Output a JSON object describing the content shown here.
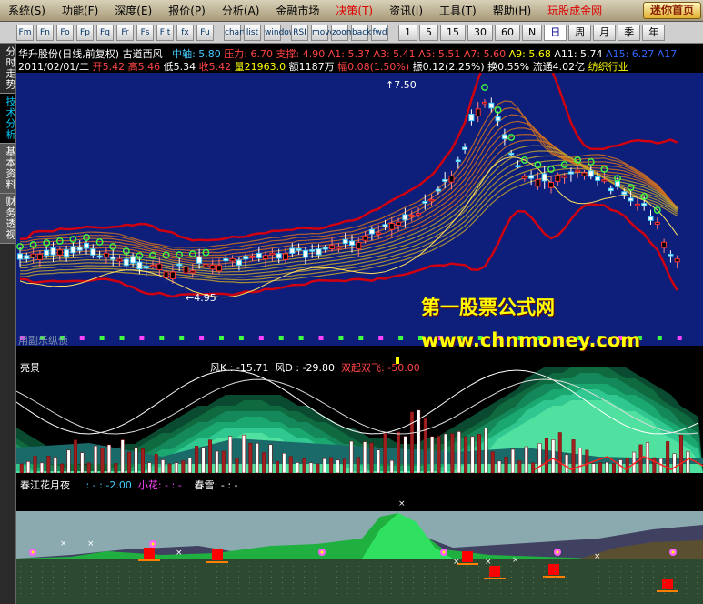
{
  "menu": {
    "items": [
      "系统(S)",
      "功能(F)",
      "深度(E)",
      "报价(P)",
      "分析(A)",
      "金融市场",
      "决策(T)",
      "资讯(I)",
      "工具(T)",
      "帮助(H)",
      "玩股成金网"
    ],
    "mini_button": "迷你首页"
  },
  "toolbar": {
    "icons": [
      "Fm",
      "Fn",
      "Fo",
      "Fp",
      "Fq",
      "Fr",
      "Fs",
      "F t",
      "fx",
      "Fu",
      "chart",
      "list",
      "window",
      "RSI",
      "move",
      "zoom",
      "back",
      "fwd"
    ],
    "periods": [
      "1",
      "5",
      "15",
      "30",
      "60",
      "N",
      "日",
      "周",
      "月",
      "季",
      "年"
    ],
    "selected_period": "日"
  },
  "left_tabs": [
    "分时走势",
    "技术分析",
    "基本资料",
    "财务透视"
  ],
  "info": {
    "stock": "华升股份(日线,前复权) 古道西风",
    "mid_label": "中轴:",
    "mid_val": "5.80",
    "press_label": "压力:",
    "press_val": "6.70",
    "support_label": "支撑:",
    "support_val": "4.90",
    "a1": "A1: 5.37",
    "a3": "A3: 5.41",
    "a5": "A5: 5.51",
    "a7": "A7: 5.60",
    "a9": "A9: 5.68",
    "a11": "A11: 5.74",
    "a15": "A15: 6.27",
    "a17": "A17",
    "date": "2011/02/01/二",
    "open": "开5.42",
    "high": "高5.46",
    "low": "低5.34",
    "close": "收5.42",
    "vol": "量21963.0",
    "amt": "额1187万",
    "range": "幅0.08(1.50%)",
    "swing": "振0.12(2.25%)",
    "turn": "换0.55%",
    "float": "流通4.02亿",
    "industry": "纺织行业"
  },
  "main_chart": {
    "high_label": "7.50",
    "low_label": "4.95",
    "ghost_text": "用副乐纵侦"
  },
  "watermark": {
    "line1": "第一股票公式网",
    "line2": "www.chnmoney.com"
  },
  "panel_mid": {
    "name": "亮景",
    "k_label": "风K",
    "k_val": ": -15.71",
    "d_label": "风D",
    "d_val": ": -29.80",
    "signal": "双起双飞: -50.00"
  },
  "panel_bot": {
    "name": "春江花月夜",
    "v1": ": -  : -2.00",
    "v2": "小花: - : -",
    "v3": "春雪: - : -"
  },
  "colors": {
    "bg": "#000000",
    "chart_bg": "#0a1a6e",
    "up": "#ff3030",
    "down": "#40d0ff",
    "band": "#d00010",
    "accent": "#ffff00"
  }
}
